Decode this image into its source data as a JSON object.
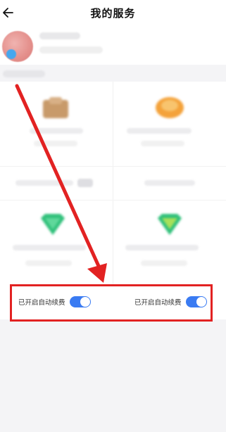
{
  "header": {
    "title": "我的服务",
    "back_icon": "arrow-left-icon"
  },
  "auto_renew": {
    "left_label": "已开启自动续费",
    "right_label": "已开启自动续费",
    "toggle_on_color": "#3a7bf2",
    "left_on": true,
    "right_on": true
  },
  "annotation": {
    "highlight_color": "#e22222",
    "arrow_color": "#e22222"
  }
}
